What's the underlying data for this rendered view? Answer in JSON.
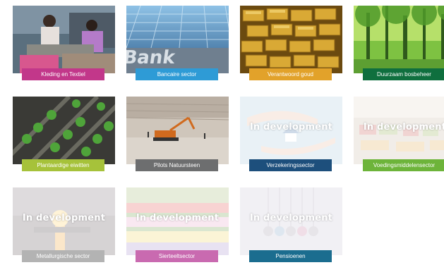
{
  "overlay_text": "In development",
  "tiles": [
    {
      "label": "Kleding en Textiel",
      "color": "#c2378a",
      "status": "active"
    },
    {
      "label": "Bancaire sector",
      "color": "#2e9bd6",
      "status": "active"
    },
    {
      "label": "Verantwoord goud",
      "color": "#e2a22a",
      "status": "active"
    },
    {
      "label": "Duurzaam bosbeheer",
      "color": "#0f6f3e",
      "status": "active"
    },
    {
      "label": "Plantaardige eiwitten",
      "color": "#a6c23a",
      "status": "active"
    },
    {
      "label": "Pilots Natuursteen",
      "color": "#6d6e6f",
      "status": "active"
    },
    {
      "label": "Verzekeringssector",
      "color": "#1d4f7c",
      "status": "in development"
    },
    {
      "label": "Voedingsmiddelensector",
      "color": "#6db43a",
      "status": "in development"
    },
    {
      "label": "Metallurgische sector",
      "color": "#b3b3b3",
      "status": "in development"
    },
    {
      "label": "Sierteeltsector",
      "color": "#c96ab0",
      "status": "in development"
    },
    {
      "label": "Pensioenen",
      "color": "#1b6d8f",
      "status": "in development"
    }
  ]
}
